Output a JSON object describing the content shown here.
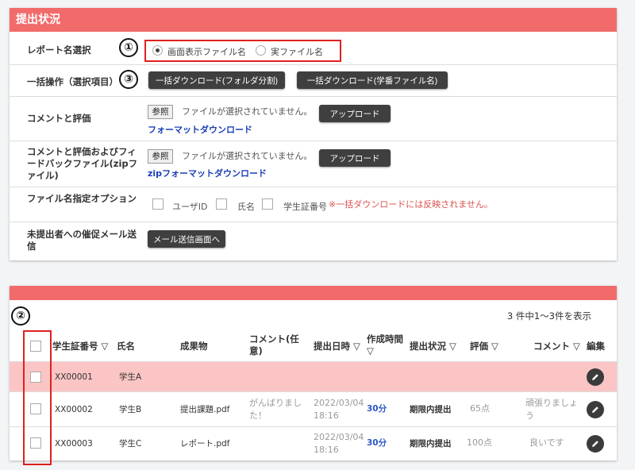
{
  "panel1": {
    "title": "提出状況",
    "report_select": {
      "label": "レポート名選択",
      "option_display": "画面表示ファイル名",
      "option_real": "実ファイル名",
      "selected": "画面表示ファイル名"
    },
    "bulk": {
      "label": "一括操作（選択項目）",
      "btn_folder": "一括ダウンロード(フォルダ分割)",
      "btn_student": "一括ダウンロード(学番ファイル名)"
    },
    "comment": {
      "label": "コメントと評価",
      "browse": "参照",
      "no_file": "ファイルが選択されていません。",
      "upload": "アップロード",
      "format_link": "フォーマットダウンロード"
    },
    "feedback": {
      "label": "コメントと評価およびフィードバックファイル(zipファイル)",
      "browse": "参照",
      "no_file": "ファイルが選択されていません。",
      "upload": "アップロード",
      "zip_link": "zipフォーマットダウンロード"
    },
    "filename_option": {
      "label": "ファイル名指定オプション",
      "user_id": "ユーザID",
      "name": "氏名",
      "student_no": "学生証番号",
      "note": "※一括ダウンロードには反映されません。"
    },
    "reminder": {
      "label": "未提出者への催促メール送信",
      "button": "メール送信画面へ"
    }
  },
  "annotations": {
    "one": "①",
    "two": "②",
    "three": "③"
  },
  "table": {
    "count_text": "3 件中1～3件を表示",
    "headers": {
      "student_no": "学生証番号 ▽",
      "name": "氏名",
      "deliverable": "成果物",
      "comment_opt": "コメント(任意)",
      "submit_dt": "提出日時 ▽",
      "work_time": "作成時間 ▽",
      "status": "提出状況 ▽",
      "grade": "評価 ▽",
      "comment": "コメント ▽",
      "edit": "編集"
    },
    "rows": [
      {
        "student_no": "XX00001",
        "name": "学生A",
        "file": "",
        "comment_opt": "",
        "date": "",
        "time": "",
        "work": "",
        "status": "",
        "grade": "",
        "comment": ""
      },
      {
        "student_no": "XX00002",
        "name": "学生B",
        "file": "提出課題.pdf",
        "comment_opt": "がんばりました！",
        "date": "2022/03/04",
        "time": "18:16",
        "work": "30分",
        "status": "期限内提出",
        "grade": "65点",
        "comment": "頑張りましょう"
      },
      {
        "student_no": "XX00003",
        "name": "学生C",
        "file": "レポート.pdf",
        "comment_opt": "",
        "date": "2022/03/04",
        "time": "18:16",
        "work": "30分",
        "status": "期限内提出",
        "grade": "100点",
        "comment": "良いです"
      }
    ]
  },
  "colors": {
    "header": "#f26b6b",
    "highlight_row": "#fbc5c5",
    "annotation": "#e02020"
  }
}
